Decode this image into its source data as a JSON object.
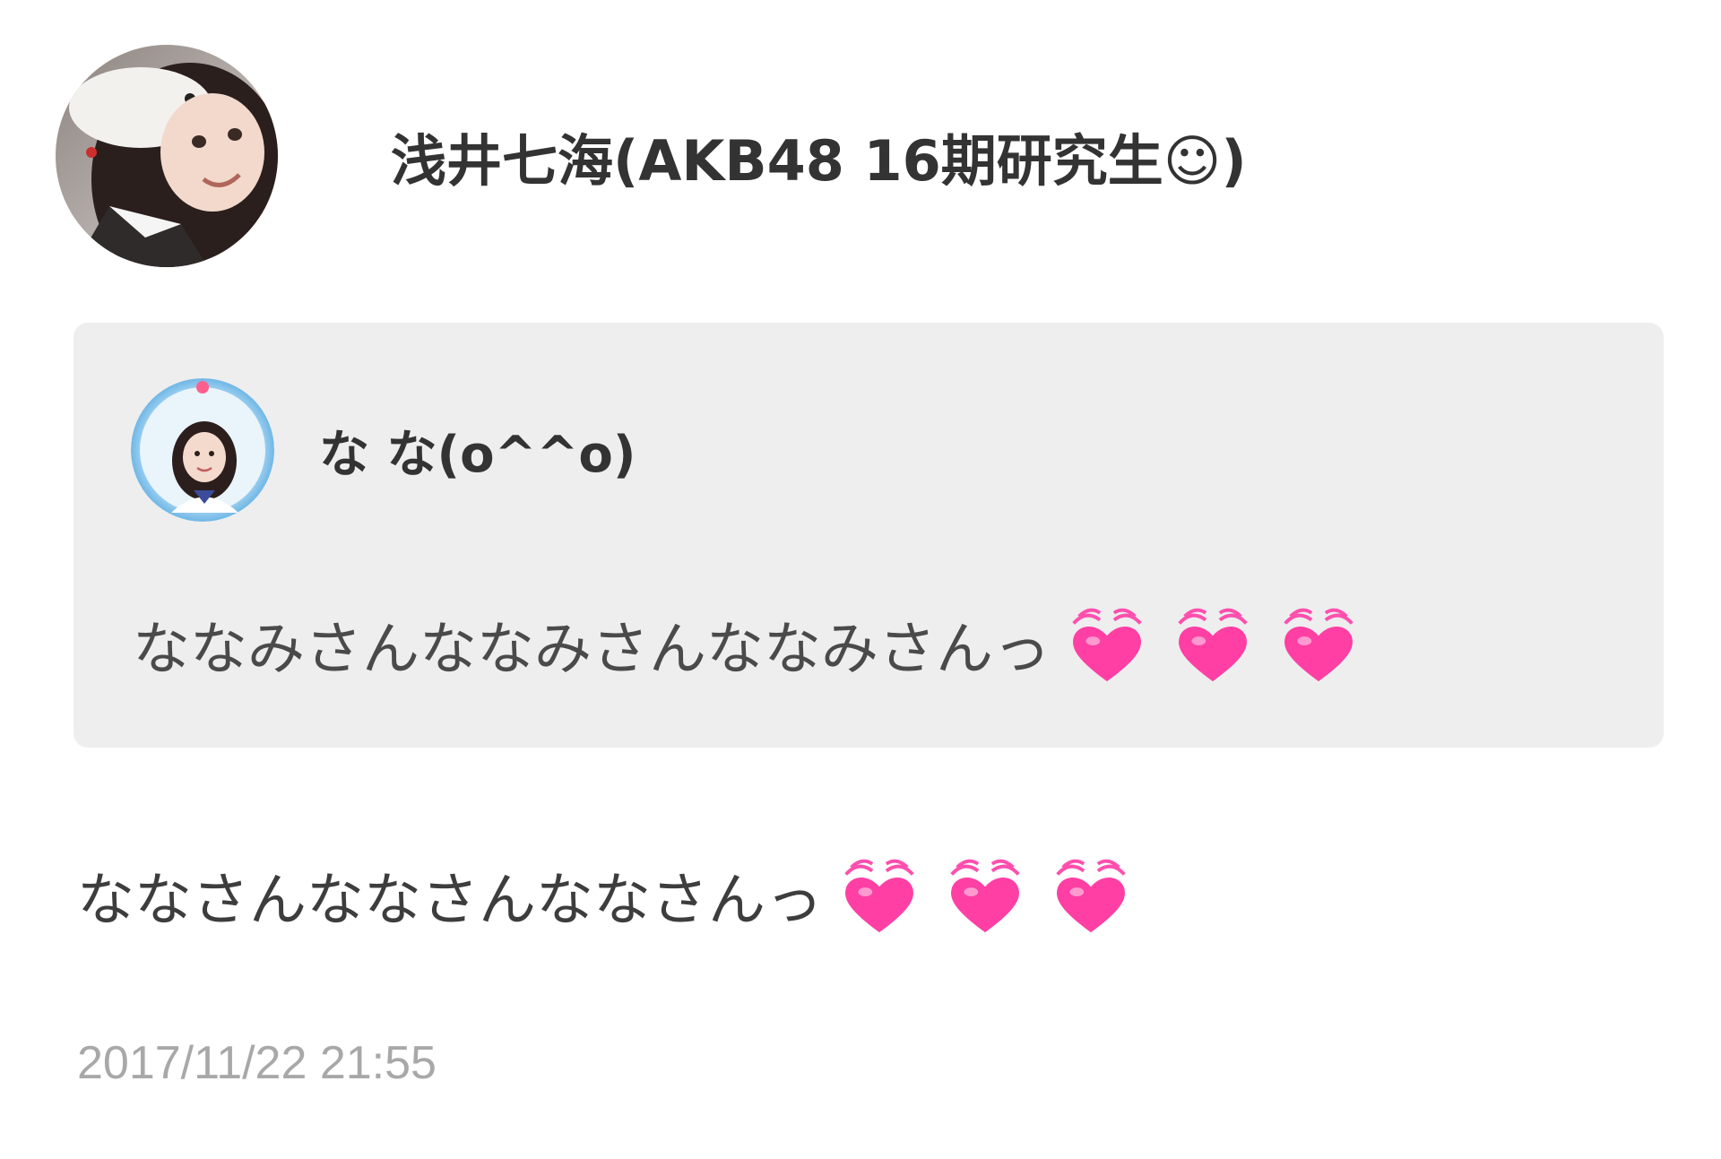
{
  "post": {
    "author": {
      "name": "浅井七海(AKB48 16期研究生☺)",
      "avatar_icon": "profile-photo-avatar"
    },
    "quote": {
      "author": {
        "name": "な な(o^^o)",
        "avatar_icon": "profile-photo-avatar"
      },
      "text": "ななみさんななみさんななみさんっ",
      "emoji_icons": [
        "beating-heart-icon",
        "beating-heart-icon",
        "beating-heart-icon"
      ]
    },
    "text": "ななさんななさんななさんっ",
    "emoji_icons": [
      "beating-heart-icon",
      "beating-heart-icon",
      "beating-heart-icon"
    ],
    "timestamp": "2017/11/22 21:55"
  },
  "colors": {
    "background": "#ffffff",
    "quote_background": "#eeeeee",
    "text": "#3d3d3d",
    "timestamp": "#a8a8a8",
    "heart": "#ff3fa4"
  }
}
